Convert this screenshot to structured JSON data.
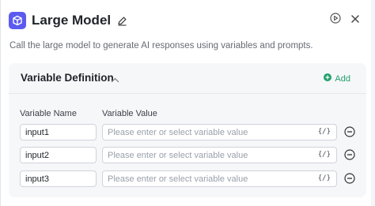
{
  "header": {
    "title": "Large Model",
    "description": "Call the large model to generate AI responses using variables and prompts."
  },
  "section": {
    "title": "Variable Definition",
    "add_label": "Add",
    "columns": {
      "name": "Variable Name",
      "value": "Variable Value"
    }
  },
  "rows": [
    {
      "name": "input1",
      "value_placeholder": "Please enter or select variable value",
      "var_icon": "{/}"
    },
    {
      "name": "input2",
      "value_placeholder": "Please enter or select variable value",
      "var_icon": "{/}"
    },
    {
      "name": "input3",
      "value_placeholder": "Please enter or select variable value",
      "var_icon": "{/}"
    }
  ],
  "colors": {
    "accent": "#5b5bf0",
    "add": "#22a06b"
  },
  "icons": [
    "cube-icon",
    "edit-icon",
    "run-icon",
    "close-icon",
    "chevron-up-icon",
    "plus-circle-icon",
    "variable-icon",
    "minus-circle-icon"
  ]
}
